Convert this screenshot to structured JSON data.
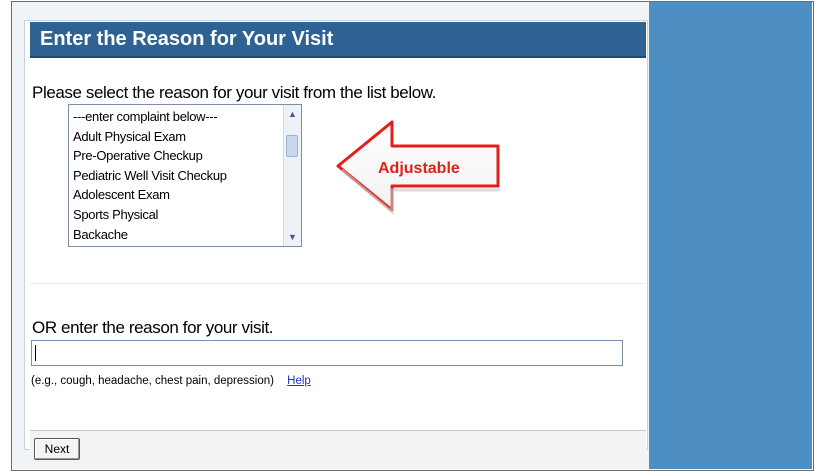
{
  "header": {
    "title": "Enter the Reason for Your Visit"
  },
  "complaint_list": {
    "prompt": "Please select the reason for your visit from the list below.",
    "items": [
      "---enter complaint below---",
      "Adult Physical Exam",
      "Pre-Operative Checkup",
      "Pediatric Well Visit Checkup",
      "Adolescent Exam",
      "Sports Physical",
      "Backache"
    ]
  },
  "callout": {
    "label": "Adjustable",
    "color": "#e0201a"
  },
  "reason_entry": {
    "label": "OR enter the reason for your visit.",
    "value": "",
    "hint": "(e.g., cough, headache, chest pain, depression)",
    "help_label": "Help"
  },
  "footer": {
    "next_label": "Next"
  },
  "colors": {
    "header_bg": "#2e6293",
    "side_panel": "#4d8ec3",
    "link": "#1a33cc"
  }
}
